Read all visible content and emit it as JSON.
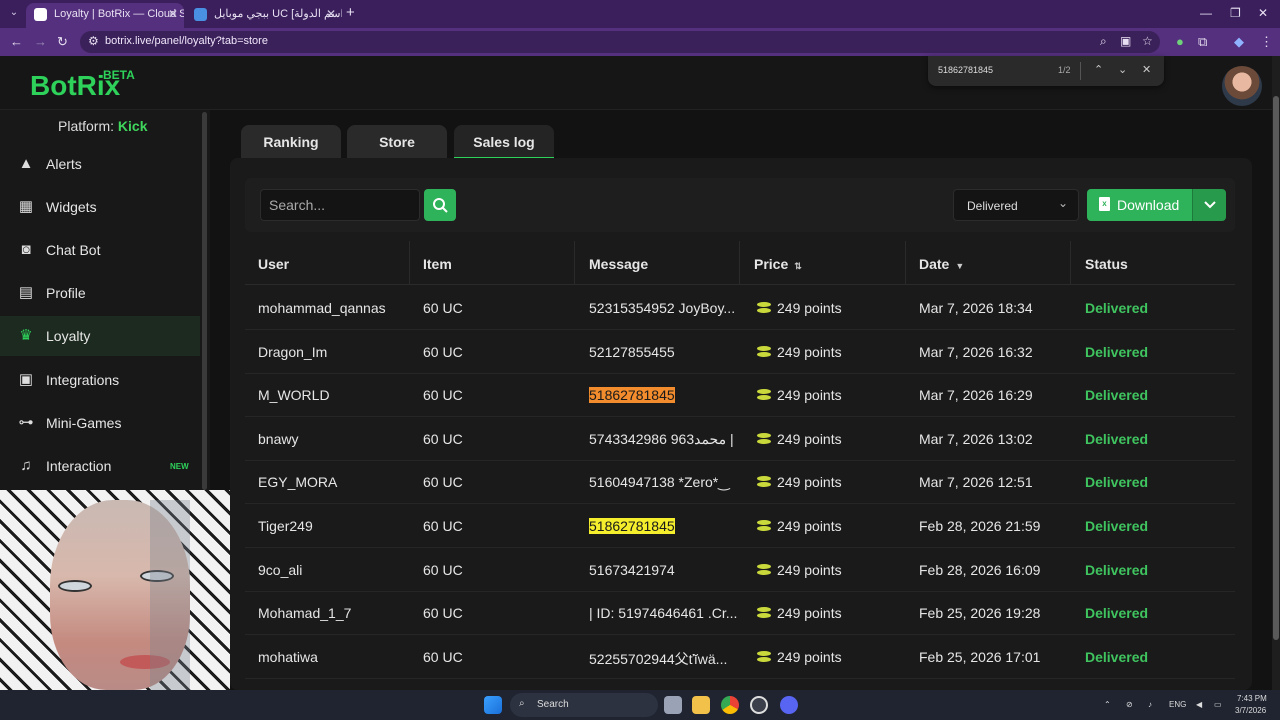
{
  "browser": {
    "tabs": [
      {
        "title": "Loyalty | BotRix — Cloud Stream",
        "favicon_color": "#ffffff"
      },
      {
        "title": "ببجي موبايل UC [اسم الدولة] | ح...",
        "favicon_color": "#4a90e2"
      }
    ],
    "url": "botrix.live/panel/loyalty?tab=store"
  },
  "find": {
    "query": "51862781845",
    "count": "1/2"
  },
  "header": {
    "logo": "BotRix",
    "beta": "BETA"
  },
  "sidebar": {
    "platform_label": "Platform:",
    "platform_value": "Kick",
    "items": [
      {
        "label": "Alerts",
        "icon": "alert-triangle-icon"
      },
      {
        "label": "Widgets",
        "icon": "grid-icon"
      },
      {
        "label": "Chat Bot",
        "icon": "robot-icon"
      },
      {
        "label": "Profile",
        "icon": "id-card-icon"
      },
      {
        "label": "Loyalty",
        "icon": "trophy-icon"
      },
      {
        "label": "Integrations",
        "icon": "chat-bubble-icon"
      },
      {
        "label": "Mini-Games",
        "icon": "gamepad-icon"
      },
      {
        "label": "Interaction",
        "icon": "music-note-icon",
        "badge": "NEW"
      }
    ]
  },
  "tabs": [
    "Ranking",
    "Store",
    "Sales log"
  ],
  "toolbar": {
    "search_placeholder": "Search...",
    "status_filter": "Delivered",
    "download_label": "Download"
  },
  "table": {
    "columns": [
      "User",
      "Item",
      "Message",
      "Price",
      "Date",
      "Status"
    ],
    "rows": [
      {
        "user": "mohammad_qannas",
        "item": "60 UC",
        "message": "52315354952 JoyBoy...",
        "price": "249 points",
        "date": "Mar 7, 2026 18:34",
        "status": "Delivered"
      },
      {
        "user": "Dragon_Im",
        "item": "60 UC",
        "message": "52127855455",
        "price": "249 points",
        "date": "Mar 7, 2026 16:32",
        "status": "Delivered"
      },
      {
        "user": "M_WORLD",
        "item": "60 UC",
        "message": "51862781845",
        "price": "249 points",
        "date": "Mar 7, 2026 16:29",
        "status": "Delivered",
        "highlight": "orange"
      },
      {
        "user": "bnawy",
        "item": "60 UC",
        "message": "5743342986 963محمد |",
        "price": "249 points",
        "date": "Mar 7, 2026 13:02",
        "status": "Delivered"
      },
      {
        "user": "EGY_MORA",
        "item": "60 UC",
        "message": "51604947138 *Zero*‿",
        "price": "249 points",
        "date": "Mar 7, 2026 12:51",
        "status": "Delivered"
      },
      {
        "user": "Tiger249",
        "item": "60 UC",
        "message": "51862781845",
        "price": "249 points",
        "date": "Feb 28, 2026 21:59",
        "status": "Delivered",
        "highlight": "yellow"
      },
      {
        "user": "9co_ali",
        "item": "60 UC",
        "message": "51673421974",
        "price": "249 points",
        "date": "Feb 28, 2026 16:09",
        "status": "Delivered"
      },
      {
        "user": "Mohamad_1_7",
        "item": "60 UC",
        "message": "| ID: 51974646461 .Cr...",
        "price": "249 points",
        "date": "Feb 25, 2026 19:28",
        "status": "Delivered"
      },
      {
        "user": "mohatiwa",
        "item": "60 UC",
        "message": "52255702944父ťĭwä...",
        "price": "249 points",
        "date": "Feb 25, 2026 17:01",
        "status": "Delivered"
      }
    ]
  },
  "taskbar": {
    "search_label": "Search",
    "lang": "ENG",
    "time": "7:43 PM",
    "date": "3/7/2026"
  },
  "colors": {
    "accent": "#2ed15a",
    "status_delivered": "#3fc45f",
    "browser_frame": "#54307e"
  }
}
